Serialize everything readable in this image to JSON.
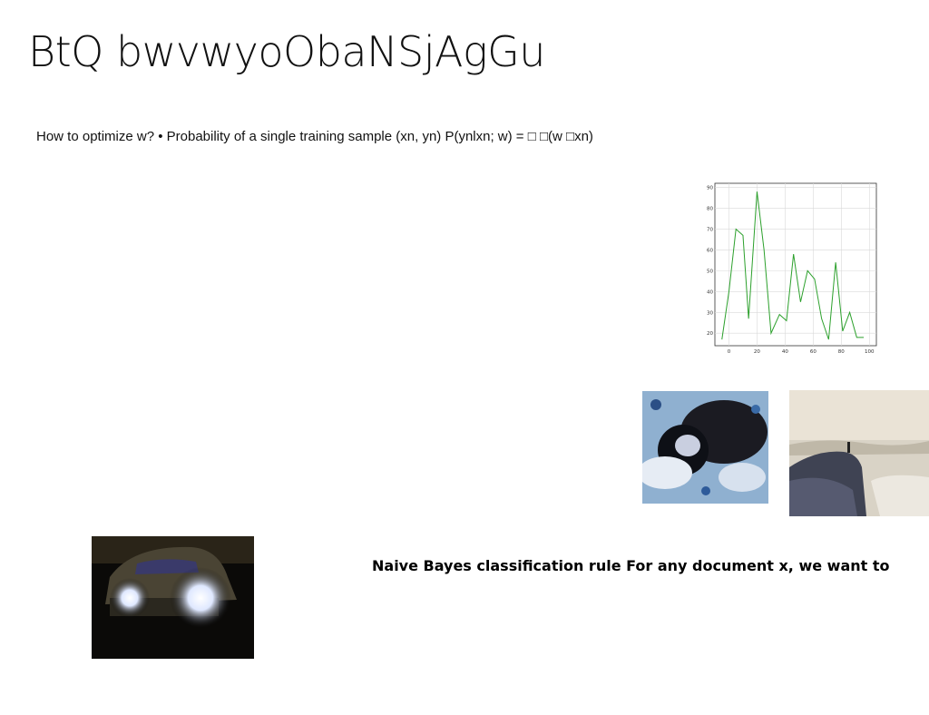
{
  "slide": {
    "title": "BtQ bwvwyoObaNSjAgGu",
    "body": "How to optimize w? • Probability of a single training sample (xn, yn) P(ynlxn; w) = □ □(w □xn)",
    "caption": "Naive Bayes classification rule For any document x, we want to"
  },
  "colors": {
    "line": "#2ca02c",
    "grid": "#d9d9d9",
    "axis": "#333333"
  },
  "chart_data": {
    "type": "line",
    "x": [
      -5,
      0,
      5,
      10,
      14,
      20,
      25,
      30,
      36,
      41,
      46,
      51,
      56,
      61,
      66,
      71,
      76,
      81,
      86,
      91,
      96
    ],
    "series": [
      {
        "values": [
          17,
          40,
          70,
          67,
          27,
          88,
          60,
          20,
          29,
          26,
          58,
          35,
          50,
          46,
          27,
          17,
          54,
          21,
          30,
          18,
          18
        ]
      }
    ],
    "xlim": [
      -10,
      105
    ],
    "ylim": [
      14,
      92
    ],
    "xticks": [
      0,
      20,
      40,
      60,
      80,
      100
    ],
    "yticks": [
      20,
      30,
      40,
      50,
      60,
      70,
      80,
      90
    ],
    "grid": true
  },
  "images": [
    {
      "name": "photo-person-lying"
    },
    {
      "name": "photo-rocky-coast"
    },
    {
      "name": "photo-car-headlights"
    }
  ]
}
